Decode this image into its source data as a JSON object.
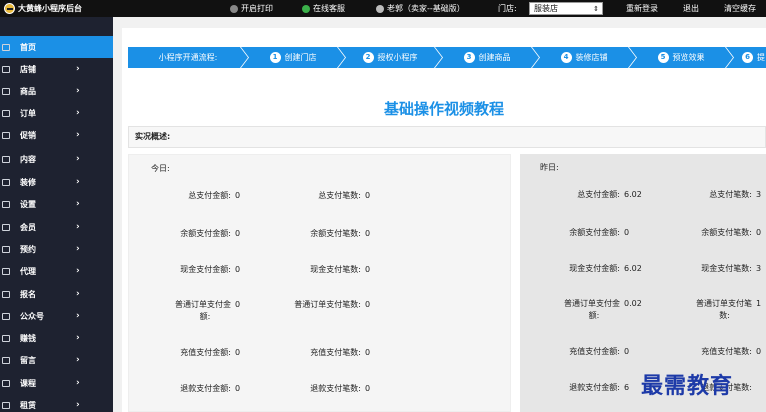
{
  "topbar": {
    "brand": "大黄蜂小程序后台",
    "print_label": "开启打印",
    "service_label": "在线客服",
    "user_label": "老郭（卖家--基础版）",
    "store_label": "门店:",
    "store_value": "服装店",
    "relogin_label": "重新登录",
    "logout_label": "退出",
    "clear_cache_label": "清空缓存"
  },
  "sidebar": {
    "items": [
      {
        "label": "首页",
        "active": true
      },
      {
        "label": "店铺"
      },
      {
        "label": "商品"
      },
      {
        "label": "订单"
      },
      {
        "label": "促销"
      },
      {
        "label": "内容"
      },
      {
        "label": "装修"
      },
      {
        "label": "设置"
      },
      {
        "label": "会员"
      },
      {
        "label": "预约"
      },
      {
        "label": "代理"
      },
      {
        "label": "报名"
      },
      {
        "label": "公众号"
      },
      {
        "label": "赚钱"
      },
      {
        "label": "留言"
      },
      {
        "label": "课程"
      },
      {
        "label": "租赁"
      }
    ]
  },
  "steps": {
    "intro": "小程序开通流程:",
    "items": [
      {
        "num": "1",
        "label": "创建门店"
      },
      {
        "num": "2",
        "label": "授权小程序"
      },
      {
        "num": "3",
        "label": "创建商品"
      },
      {
        "num": "4",
        "label": "装修店铺"
      },
      {
        "num": "5",
        "label": "预览效果"
      },
      {
        "num": "6",
        "label": "提"
      }
    ]
  },
  "video_title": "基础操作视频教程",
  "overview_label": "实况概述:",
  "today": {
    "label": "今日:",
    "rows": [
      {
        "k1": "总支付金额:",
        "v1": "0",
        "k2": "总支付笔数:",
        "v2": "0"
      },
      {
        "k1": "余额支付金额:",
        "v1": "0",
        "k2": "余额支付笔数:",
        "v2": "0"
      },
      {
        "k1": "现金支付金额:",
        "v1": "0",
        "k2": "现金支付笔数:",
        "v2": "0"
      },
      {
        "k1a": "普通订单支付金",
        "k1b": "额:",
        "v1": "0",
        "k2": "普通订单支付笔数:",
        "v2": "0"
      },
      {
        "k1": "充值支付金额:",
        "v1": "0",
        "k2": "充值支付笔数:",
        "v2": "0"
      },
      {
        "k1": "退款支付金额:",
        "v1": "0",
        "k2": "退款支付笔数:",
        "v2": "0"
      }
    ]
  },
  "yesterday": {
    "label": "昨日:",
    "rows": [
      {
        "k1": "总支付金额:",
        "v1": "6.02",
        "k2": "总支付笔数:",
        "v2": "3"
      },
      {
        "k1": "余额支付金额:",
        "v1": "0",
        "k2": "余额支付笔数:",
        "v2": "0"
      },
      {
        "k1": "现金支付金额:",
        "v1": "6.02",
        "k2": "现金支付笔数:",
        "v2": "3"
      },
      {
        "k1a": "普通订单支付金",
        "k1b": "额:",
        "v1": "0.02",
        "k2a": "普通订单支付笔",
        "k2b": "数:",
        "v2": "1"
      },
      {
        "k1": "充值支付金额:",
        "v1": "0",
        "k2": "充值支付笔数:",
        "v2": "0"
      },
      {
        "k1": "退款支付金额:",
        "v1": "6",
        "k2": "退款支付笔数:",
        "v2": ""
      }
    ]
  },
  "watermark": "最需教育",
  "colors": {
    "accent": "#1b90e6",
    "sidebar_bg": "#1e2230",
    "topbar_bg": "#111111"
  }
}
